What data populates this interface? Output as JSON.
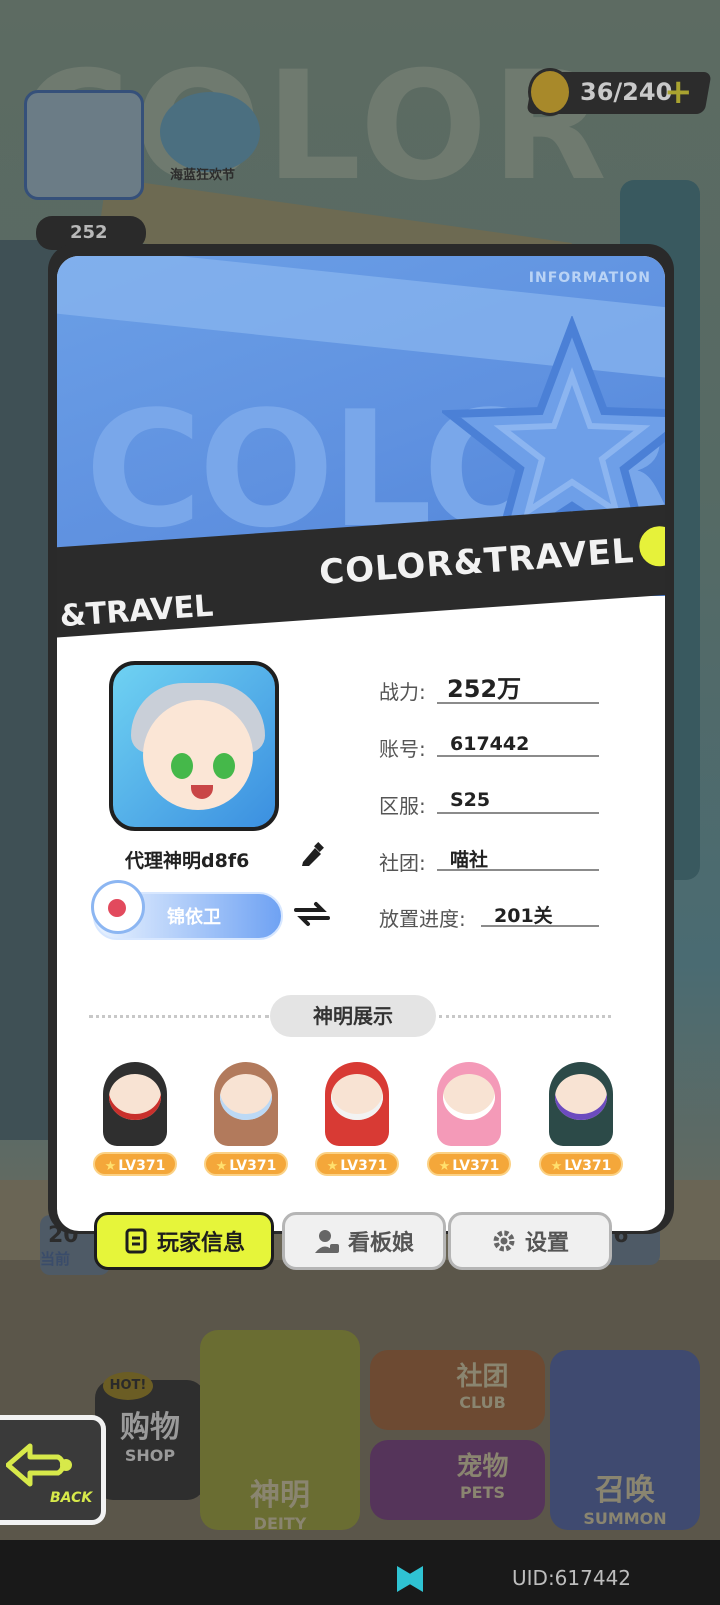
{
  "background": {
    "energy": {
      "value": "36/240",
      "plus": "+"
    },
    "event_label": "海蓝狂欢节",
    "power_short": "252",
    "left_number": "20",
    "left_caption": "当前",
    "right_number": "26",
    "menu": {
      "shop": {
        "hot": "HOT!",
        "zh": "购物",
        "en": "SHOP"
      },
      "deity": {
        "zh": "神明",
        "en": "DEITY"
      },
      "club": {
        "zh": "社团",
        "en": "CLUB"
      },
      "pets": {
        "zh": "宠物",
        "en": "PETS"
      },
      "summon": {
        "zh": "召唤",
        "en": "SUMMON"
      }
    }
  },
  "banner": {
    "word": "COLOR",
    "info": "INFORMATION",
    "ribbon_main": "COLOR&TRAVEL",
    "ribbon_left": "&TRAVEL"
  },
  "player": {
    "name": "代理神明d8f6",
    "title_badge": "锦依卫"
  },
  "stats": [
    {
      "label": "战力:",
      "value": "252万"
    },
    {
      "label": "账号:",
      "value": "617442"
    },
    {
      "label": "区服:",
      "value": "S25"
    },
    {
      "label": "社团:",
      "value": "喵社"
    },
    {
      "label": "放置进度:",
      "value": "201关"
    }
  ],
  "showcase": {
    "title": "神明展示",
    "deities": [
      {
        "level": "LV371",
        "color": "#2f2f2f",
        "accent": "#c9302c"
      },
      {
        "level": "LV371",
        "color": "#b27a5c",
        "accent": "#bcd9f5"
      },
      {
        "level": "LV371",
        "color": "#d83a34",
        "accent": "#f2f2f2"
      },
      {
        "level": "LV371",
        "color": "#f49ab8",
        "accent": "#ffffff"
      },
      {
        "level": "LV371",
        "color": "#2c4a48",
        "accent": "#6c4bbf"
      }
    ]
  },
  "tabs": {
    "player_info": "玩家信息",
    "kanban": "看板娘",
    "settings": "设置"
  },
  "back": {
    "label": "BACK"
  },
  "footer": {
    "uid": "UID:617442"
  },
  "colors": {
    "accent_yellow": "#e6f53a",
    "banner_blue": "#5f91e0",
    "level_orange": "#f4a73a"
  }
}
